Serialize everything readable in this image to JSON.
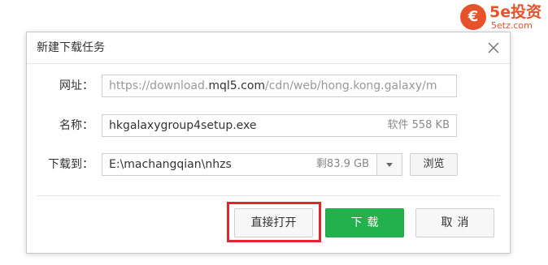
{
  "watermark": {
    "logo_char": "€",
    "brand": "5e投资",
    "site": "5etz.com",
    "color": "#e8522a"
  },
  "dialog": {
    "title": "新建下载任务",
    "close_icon": "close-icon"
  },
  "form": {
    "url_label": "网址：",
    "url_prefix": "https://download.",
    "url_domain": "mql5.com",
    "url_suffix": "/cdn/web/hong.kong.galaxy/m",
    "name_label": "名称：",
    "name_value": "hkgalaxygroup4setup.exe",
    "name_meta": "软件 558 KB",
    "path_label": "下载到：",
    "path_value": "E:\\machangqian\\nhzs",
    "path_meta": "剩83.9 GB",
    "dropdown_icon": "chevron-down-icon",
    "browse_label": "浏览"
  },
  "actions": {
    "open_label": "直接打开",
    "download_label": "下载",
    "cancel_label": "取消",
    "download_color": "#22b14c",
    "highlight_color": "#e0262f"
  }
}
